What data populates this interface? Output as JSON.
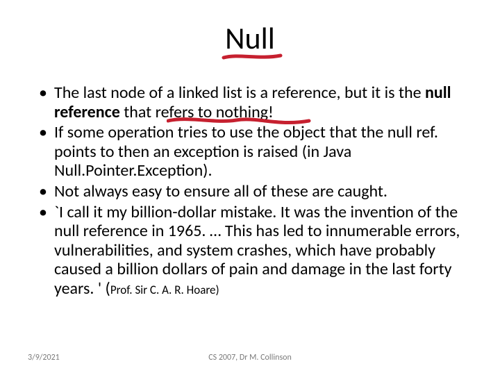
{
  "title": "Null",
  "bullets": [
    {
      "pre": "The last node of a linked list is a reference, but it is the ",
      "bold": "null reference ",
      "post": "that refers to nothing!"
    },
    {
      "pre": "If some operation tries to use the object that the null ref. points to then an exception is raised (in Java Null.Pointer.Exception).",
      "bold": "",
      "post": ""
    },
    {
      "pre": "Not always easy to ensure all of these are caught.",
      "bold": "",
      "post": ""
    },
    {
      "pre": "`I call it my billion-dollar mistake. It was the invention of the null reference in 1965. … This has led to innumerable errors, vulnerabilities, and system crashes, which have probably caused a billion dollars of pain and damage in the last forty years. ' (",
      "bold": "",
      "post": "",
      "attr": "Prof. Sir C. A. R. Hoare)"
    }
  ],
  "footer": {
    "date": "3/9/2021",
    "course": "CS 2007,  Dr M. Collinson"
  },
  "annotation_color": "#c6202f"
}
